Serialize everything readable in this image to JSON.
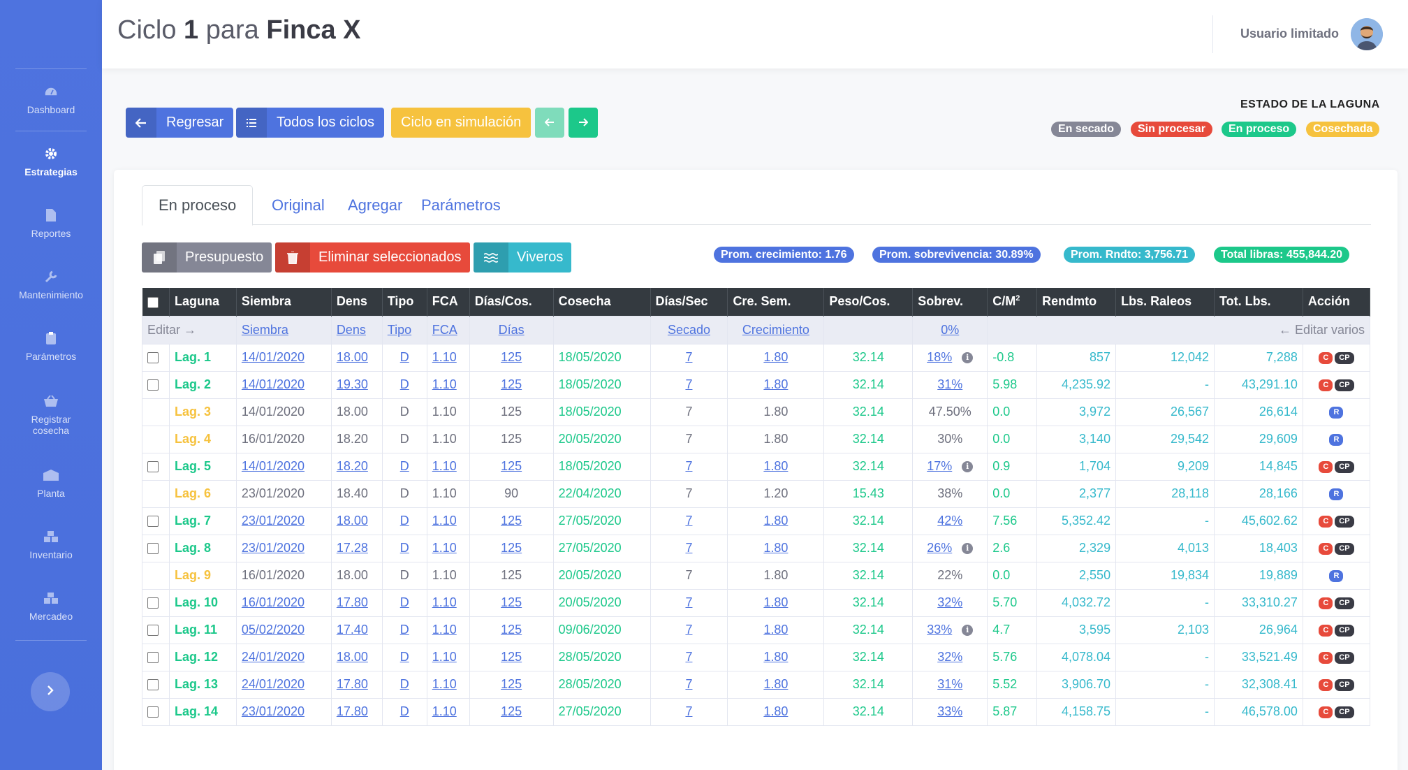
{
  "sidebar": {
    "items": [
      {
        "label": "Dashboard",
        "icon": "dashboard-icon"
      },
      {
        "label": "Estrategias",
        "icon": "gear-icon",
        "active": true
      },
      {
        "label": "Reportes",
        "icon": "file-icon"
      },
      {
        "label": "Mantenimiento",
        "icon": "wrench-icon"
      },
      {
        "label": "Parámetros",
        "icon": "clipboard-icon"
      },
      {
        "label": "Registrar cosecha",
        "icon": "basket-icon"
      },
      {
        "label": "Planta",
        "icon": "warehouse-icon"
      },
      {
        "label": "Inventario",
        "icon": "boxes-icon"
      },
      {
        "label": "Mercadeo",
        "icon": "boxes-icon"
      }
    ],
    "toggle_icon": "chevron-right-icon"
  },
  "header": {
    "title_prefix": "Ciclo",
    "cycle_number": "1",
    "title_middle": "para",
    "farm_name": "Finca X",
    "user_name": "Usuario limitado"
  },
  "actions": {
    "back_label": "Regresar",
    "all_cycles_label": "Todos los ciclos",
    "simulation_label": "Ciclo en simulación"
  },
  "legend": {
    "title": "ESTADO DE LA LAGUNA",
    "states": [
      {
        "label": "En secado",
        "color": "#858796"
      },
      {
        "label": "Sin procesar",
        "color": "#e74a3b"
      },
      {
        "label": "En proceso",
        "color": "#1cc88a"
      },
      {
        "label": "Cosechada",
        "color": "#f6c23e"
      }
    ]
  },
  "tabs": [
    "En proceso",
    "Original",
    "Agregar",
    "Parámetros"
  ],
  "toolbar": {
    "budget_label": "Presupuesto",
    "delete_label": "Eliminar seleccionados",
    "nursery_label": "Viveros"
  },
  "stats": {
    "growth": "Prom. crecimiento: 1.76",
    "survival": "Prom. sobrevivencia: 30.89%",
    "yield": "Prom. Rndto: 3,756.71",
    "total": "Total libras: 455,844.20"
  },
  "table": {
    "headers": [
      "Laguna",
      "Siembra",
      "Dens",
      "Tipo",
      "FCA",
      "Días/Cos.",
      "Cosecha",
      "Días/Sec",
      "Cre. Sem.",
      "Peso/Cos.",
      "Sobrev.",
      "C/M",
      "Rendmto",
      "Lbs. Raleos",
      "Tot. Lbs.",
      "Acción"
    ],
    "cm_superscript": "2",
    "edit_row": {
      "edit": "Editar →",
      "siembra": "Siembra",
      "dens": "Dens",
      "tipo": "Tipo",
      "fca": "FCA",
      "dias": "Días",
      "secado": "Secado",
      "crecimiento": "Crecimiento",
      "sobrev": "0%",
      "edit_many": "← Editar varios"
    },
    "rows": [
      {
        "laguna": "Lag. 1",
        "siembra": "14/01/2020",
        "dens": "18.00",
        "tipo": "D",
        "fca": "1.10",
        "dias": "125",
        "cosecha": "18/05/2020",
        "sec": "7",
        "cre": "1.80",
        "peso": "32.14",
        "sobrev": "18%",
        "cm": "-0.8",
        "rend": "857",
        "raleos": "12,042",
        "tot": "7,288",
        "status": "process",
        "info": true
      },
      {
        "laguna": "Lag. 2",
        "siembra": "14/01/2020",
        "dens": "19.30",
        "tipo": "D",
        "fca": "1.10",
        "dias": "125",
        "cosecha": "18/05/2020",
        "sec": "7",
        "cre": "1.80",
        "peso": "32.14",
        "sobrev": "31%",
        "cm": "5.98",
        "rend": "4,235.92",
        "raleos": "-",
        "tot": "43,291.10",
        "status": "process",
        "info": false
      },
      {
        "laguna": "Lag. 3",
        "siembra": "14/01/2020",
        "dens": "18.00",
        "tipo": "D",
        "fca": "1.10",
        "dias": "125",
        "cosecha": "18/05/2020",
        "sec": "7",
        "cre": "1.80",
        "peso": "32.14",
        "sobrev": "47.50%",
        "cm": "0.0",
        "rend": "3,972",
        "raleos": "26,567",
        "tot": "26,614",
        "status": "harvested",
        "info": false
      },
      {
        "laguna": "Lag. 4",
        "siembra": "16/01/2020",
        "dens": "18.20",
        "tipo": "D",
        "fca": "1.10",
        "dias": "125",
        "cosecha": "20/05/2020",
        "sec": "7",
        "cre": "1.80",
        "peso": "32.14",
        "sobrev": "30%",
        "cm": "0.0",
        "rend": "3,140",
        "raleos": "29,542",
        "tot": "29,609",
        "status": "harvested",
        "info": false
      },
      {
        "laguna": "Lag. 5",
        "siembra": "14/01/2020",
        "dens": "18.20",
        "tipo": "D",
        "fca": "1.10",
        "dias": "125",
        "cosecha": "18/05/2020",
        "sec": "7",
        "cre": "1.80",
        "peso": "32.14",
        "sobrev": "17%",
        "cm": "0.9",
        "rend": "1,704",
        "raleos": "9,209",
        "tot": "14,845",
        "status": "process",
        "info": true
      },
      {
        "laguna": "Lag. 6",
        "siembra": "23/01/2020",
        "dens": "18.40",
        "tipo": "D",
        "fca": "1.10",
        "dias": "90",
        "cosecha": "22/04/2020",
        "sec": "7",
        "cre": "1.20",
        "peso": "15.43",
        "sobrev": "38%",
        "cm": "0.0",
        "rend": "2,377",
        "raleos": "28,118",
        "tot": "28,166",
        "status": "harvested",
        "info": false
      },
      {
        "laguna": "Lag. 7",
        "siembra": "23/01/2020",
        "dens": "18.00",
        "tipo": "D",
        "fca": "1.10",
        "dias": "125",
        "cosecha": "27/05/2020",
        "sec": "7",
        "cre": "1.80",
        "peso": "32.14",
        "sobrev": "42%",
        "cm": "7.56",
        "rend": "5,352.42",
        "raleos": "-",
        "tot": "45,602.62",
        "status": "process",
        "info": false
      },
      {
        "laguna": "Lag. 8",
        "siembra": "23/01/2020",
        "dens": "17.28",
        "tipo": "D",
        "fca": "1.10",
        "dias": "125",
        "cosecha": "27/05/2020",
        "sec": "7",
        "cre": "1.80",
        "peso": "32.14",
        "sobrev": "26%",
        "cm": "2.6",
        "rend": "2,329",
        "raleos": "4,013",
        "tot": "18,403",
        "status": "process",
        "info": true
      },
      {
        "laguna": "Lag. 9",
        "siembra": "16/01/2020",
        "dens": "18.00",
        "tipo": "D",
        "fca": "1.10",
        "dias": "125",
        "cosecha": "20/05/2020",
        "sec": "7",
        "cre": "1.80",
        "peso": "32.14",
        "sobrev": "22%",
        "cm": "0.0",
        "rend": "2,550",
        "raleos": "19,834",
        "tot": "19,889",
        "status": "harvested",
        "info": false
      },
      {
        "laguna": "Lag. 10",
        "siembra": "16/01/2020",
        "dens": "17.80",
        "tipo": "D",
        "fca": "1.10",
        "dias": "125",
        "cosecha": "20/05/2020",
        "sec": "7",
        "cre": "1.80",
        "peso": "32.14",
        "sobrev": "32%",
        "cm": "5.70",
        "rend": "4,032.72",
        "raleos": "-",
        "tot": "33,310.27",
        "status": "process",
        "info": false
      },
      {
        "laguna": "Lag. 11",
        "siembra": "05/02/2020",
        "dens": "17.40",
        "tipo": "D",
        "fca": "1.10",
        "dias": "125",
        "cosecha": "09/06/2020",
        "sec": "7",
        "cre": "1.80",
        "peso": "32.14",
        "sobrev": "33%",
        "cm": "4.7",
        "rend": "3,595",
        "raleos": "2,103",
        "tot": "26,964",
        "status": "process",
        "info": true
      },
      {
        "laguna": "Lag. 12",
        "siembra": "24/01/2020",
        "dens": "18.00",
        "tipo": "D",
        "fca": "1.10",
        "dias": "125",
        "cosecha": "28/05/2020",
        "sec": "7",
        "cre": "1.80",
        "peso": "32.14",
        "sobrev": "32%",
        "cm": "5.76",
        "rend": "4,078.04",
        "raleos": "-",
        "tot": "33,521.49",
        "status": "process",
        "info": false
      },
      {
        "laguna": "Lag. 13",
        "siembra": "24/01/2020",
        "dens": "17.80",
        "tipo": "D",
        "fca": "1.10",
        "dias": "125",
        "cosecha": "28/05/2020",
        "sec": "7",
        "cre": "1.80",
        "peso": "32.14",
        "sobrev": "31%",
        "cm": "5.52",
        "rend": "3,906.70",
        "raleos": "-",
        "tot": "32,308.41",
        "status": "process",
        "info": false
      },
      {
        "laguna": "Lag. 14",
        "siembra": "23/01/2020",
        "dens": "17.80",
        "tipo": "D",
        "fca": "1.10",
        "dias": "125",
        "cosecha": "27/05/2020",
        "sec": "7",
        "cre": "1.80",
        "peso": "32.14",
        "sobrev": "33%",
        "cm": "5.87",
        "rend": "4,158.75",
        "raleos": "-",
        "tot": "46,578.00",
        "status": "process",
        "info": false
      }
    ],
    "action_labels": {
      "c": "C",
      "cp": "CP",
      "r": "R"
    }
  }
}
